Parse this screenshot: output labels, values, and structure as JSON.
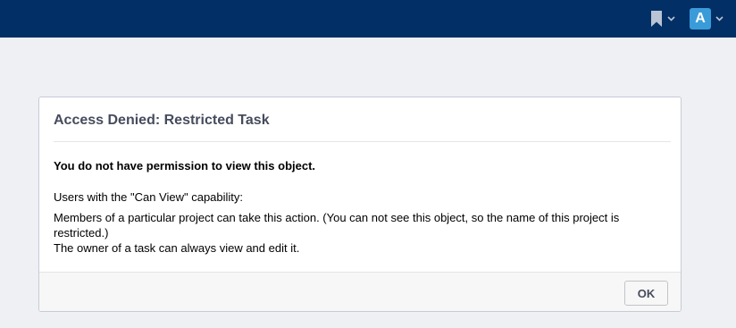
{
  "topbar": {
    "background": "#023066",
    "bookmark": {
      "icon": "bookmark-icon",
      "dropdown_icon": "chevron-down-icon"
    },
    "user": {
      "avatar_letter": "A",
      "avatar_color": "#3a9bd9",
      "dropdown_icon": "chevron-down-icon"
    }
  },
  "dialog": {
    "title": "Access Denied: Restricted Task",
    "message": "You do not have permission to view this object.",
    "capability_heading": "Users with the \"Can View\" capability:",
    "capabilities": [
      "Members of a particular project can take this action. (You can not see this object, so the name of this project is restricted.)",
      "The owner of a task can always view and edit it."
    ],
    "ok_label": "OK"
  }
}
